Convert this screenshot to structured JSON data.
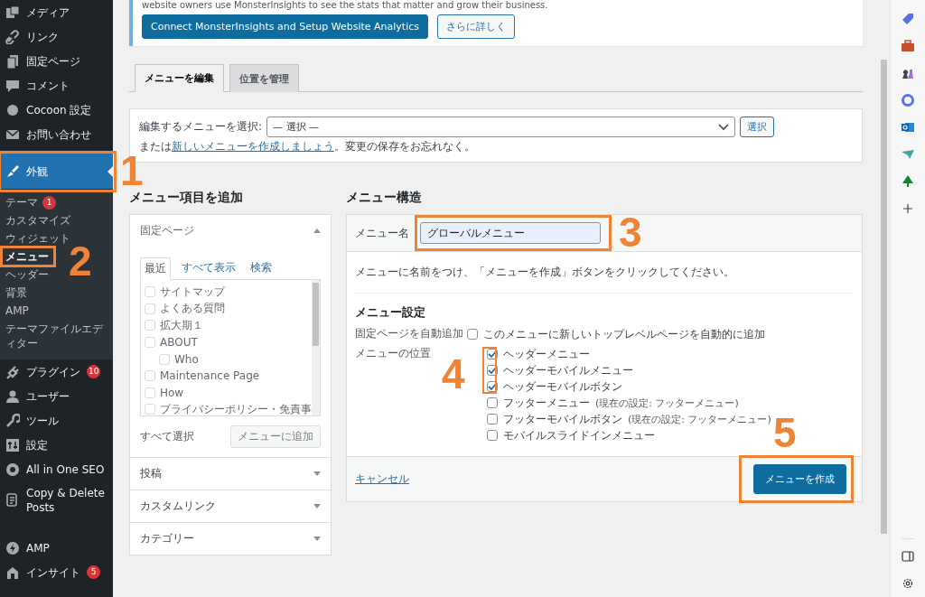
{
  "admin_menu": [
    {
      "label": "メディア"
    },
    {
      "label": "リンク"
    },
    {
      "label": "固定ページ"
    },
    {
      "label": "コメント"
    },
    {
      "label": "Cocoon 設定"
    },
    {
      "label": "お問い合わせ"
    },
    {
      "label": "外観",
      "selected": true,
      "callout": "1",
      "children": [
        {
          "label": "テーマ",
          "selected": false,
          "badge": "1"
        },
        {
          "label": "カスタマイズ",
          "selected": false
        },
        {
          "label": "ウィジェット",
          "selected": false
        },
        {
          "label": "メニュー",
          "selected": true,
          "callout": "2"
        },
        {
          "label": "ヘッダー",
          "selected": false
        },
        {
          "label": "背景",
          "selected": false
        },
        {
          "label": "AMP",
          "selected": false
        },
        {
          "label": "テーマファイルエディター",
          "selected": false
        }
      ]
    },
    {
      "label": "プラグイン",
      "selected": false,
      "badge": "10"
    },
    {
      "label": "ユーザー",
      "selected": false
    },
    {
      "label": "ツール",
      "selected": false
    },
    {
      "label": "設定",
      "selected": false
    },
    {
      "label": "All in One SEO",
      "selected": false
    },
    {
      "label": "Copy & Delete Posts",
      "selected": false
    },
    {
      "label": "AMP",
      "selected": false,
      "gap_before": true
    },
    {
      "label": "インサイト",
      "selected": false,
      "badge": "5"
    }
  ],
  "notice": {
    "text": "website owners use MonsterInsights to see the stats that matter and grow their business.",
    "primary_button": "Connect MonsterInsights and Setup Website Analytics",
    "secondary_button": "さらに詳しく"
  },
  "tabs": [
    {
      "label": "メニューを編集",
      "selected": true
    },
    {
      "label": "位置を管理",
      "selected": false
    }
  ],
  "select_menu": {
    "label": "編集するメニューを選択:",
    "value": "— 選択 —",
    "button": "選択",
    "hint_before": "または",
    "hint_link": "新しいメニューを作成しましょう",
    "hint_after": "。変更の保存をお忘れなく。"
  },
  "add_items": {
    "title": "メニュー項目を追加",
    "sections": [
      {
        "title": "固定ページ",
        "expanded": true,
        "inner_tabs": [
          {
            "label": "最近",
            "selected": true
          },
          {
            "label": "すべて表示",
            "selected": false
          },
          {
            "label": "検索",
            "selected": false
          }
        ],
        "pages": [
          {
            "label": "サイトマップ"
          },
          {
            "label": "よくある質問"
          },
          {
            "label": "拡大期１"
          },
          {
            "label": "ABOUT",
            "children": [
              {
                "label": "Who"
              }
            ]
          },
          {
            "label": "Maintenance Page"
          },
          {
            "label": "How"
          },
          {
            "label": "プライバシーポリシー・免責事"
          }
        ],
        "select_all": "すべて選択",
        "add_button": "メニューに追加",
        "disabled": true
      },
      {
        "title": "投稿",
        "expanded": false
      },
      {
        "title": "カスタムリンク",
        "expanded": false
      },
      {
        "title": "カテゴリー",
        "expanded": false
      }
    ]
  },
  "structure": {
    "title": "メニュー構造",
    "name_label": "メニュー名",
    "name_value": "グローバルメニュー",
    "name_callout": "3",
    "instruction": "メニューに名前をつけ、「メニューを作成」ボタンをクリックしてください。",
    "settings_title": "メニュー設定",
    "auto_add": {
      "label": "固定ページを自動追加",
      "option": "このメニューに新しいトップレベルページを自動的に追加",
      "checked": false
    },
    "locations_label": "メニューの位置",
    "locations_callout": "4",
    "locations": [
      {
        "label": "ヘッダーメニュー",
        "checked": true
      },
      {
        "label": "ヘッダーモバイルメニュー",
        "checked": true
      },
      {
        "label": "ヘッダーモバイルボタン",
        "checked": true
      },
      {
        "label": "フッターメニュー",
        "note": "(現在の設定: フッターメニュー)",
        "checked": false
      },
      {
        "label": "フッターモバイルボタン",
        "note": "(現在の設定: フッターメニュー)",
        "checked": false
      },
      {
        "label": "モバイルスライドインメニュー",
        "checked": false
      }
    ],
    "cancel": "キャンセル",
    "create_button": "メニューを作成",
    "create_callout": "5"
  }
}
